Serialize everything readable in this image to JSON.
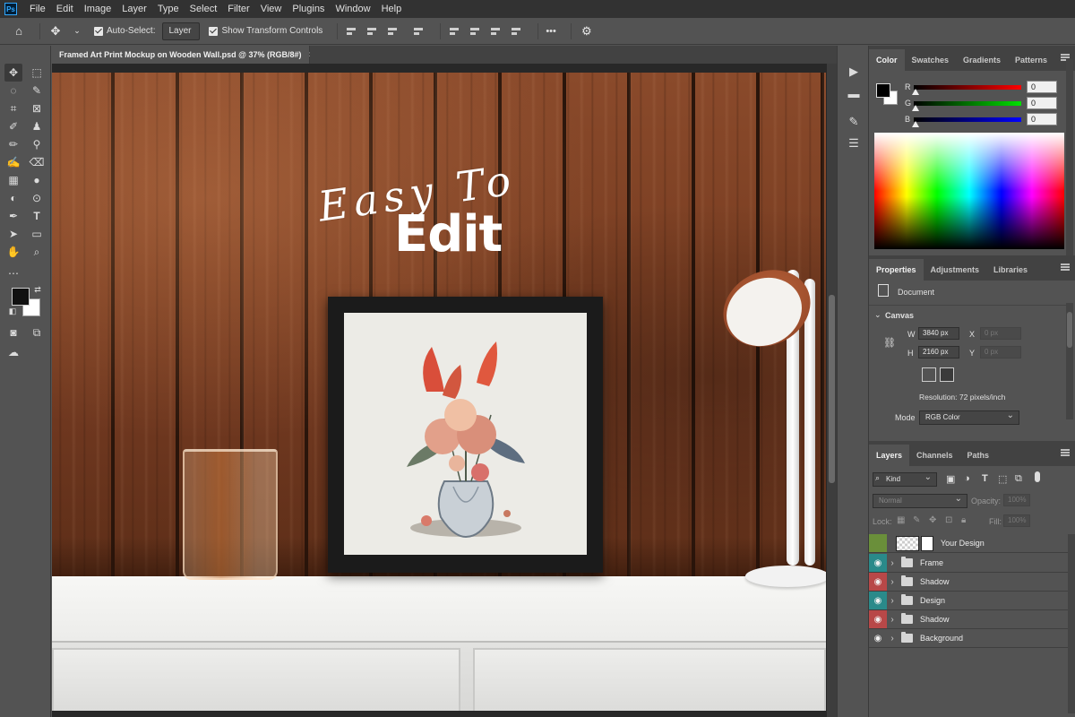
{
  "menubar": {
    "logo": "Ps",
    "items": [
      "File",
      "Edit",
      "Image",
      "Layer",
      "Type",
      "Select",
      "Filter",
      "View",
      "Plugins",
      "Window",
      "Help"
    ]
  },
  "options": {
    "auto_select_label": "Auto-Select:",
    "auto_select_value": "Layer",
    "show_transform_label": "Show Transform Controls",
    "more": "•••"
  },
  "document": {
    "tab_title": "Framed Art Print Mockup on Wooden Wall.psd @ 37% (RGB/8#)",
    "close": "×"
  },
  "canvas": {
    "headline_script": "Easy To",
    "headline_bold": "Edit"
  },
  "color_panel": {
    "tabs": [
      "Color",
      "Swatches",
      "Gradients",
      "Patterns"
    ],
    "active_tab": "Color",
    "channels": [
      {
        "label": "R",
        "value": "0",
        "color": "#ff0000"
      },
      {
        "label": "G",
        "value": "0",
        "color": "#00c000"
      },
      {
        "label": "B",
        "value": "0",
        "color": "#0000ff"
      }
    ]
  },
  "properties_panel": {
    "tabs": [
      "Properties",
      "Adjustments",
      "Libraries"
    ],
    "active_tab": "Properties",
    "document_label": "Document",
    "canvas_section": "Canvas",
    "width_label": "W",
    "width_value": "3840 px",
    "height_label": "H",
    "height_value": "2160 px",
    "x_label": "X",
    "x_placeholder": "0 px",
    "y_label": "Y",
    "y_placeholder": "0 px",
    "resolution": "Resolution: 72 pixels/inch",
    "mode_label": "Mode",
    "mode_value": "RGB Color"
  },
  "layers_panel": {
    "tabs": [
      "Layers",
      "Channels",
      "Paths"
    ],
    "active_tab": "Layers",
    "filter_kind": "Kind",
    "blend_mode": "Normal",
    "opacity_label": "Opacity:",
    "opacity_value": "100%",
    "lock_label": "Lock:",
    "fill_label": "Fill:",
    "fill_value": "100%",
    "layers": [
      {
        "name": "Your Design",
        "eye_color": "#6a8f3a",
        "type": "smart-object"
      },
      {
        "name": "Frame",
        "eye_color": "#2a8a8a",
        "type": "group"
      },
      {
        "name": "Shadow",
        "eye_color": "#b84848",
        "type": "group"
      },
      {
        "name": "Design",
        "eye_color": "#2a8a8a",
        "type": "group"
      },
      {
        "name": "Shadow",
        "eye_color": "#b84848",
        "type": "group"
      },
      {
        "name": "Background",
        "eye_color": "#535353",
        "type": "group"
      }
    ]
  }
}
